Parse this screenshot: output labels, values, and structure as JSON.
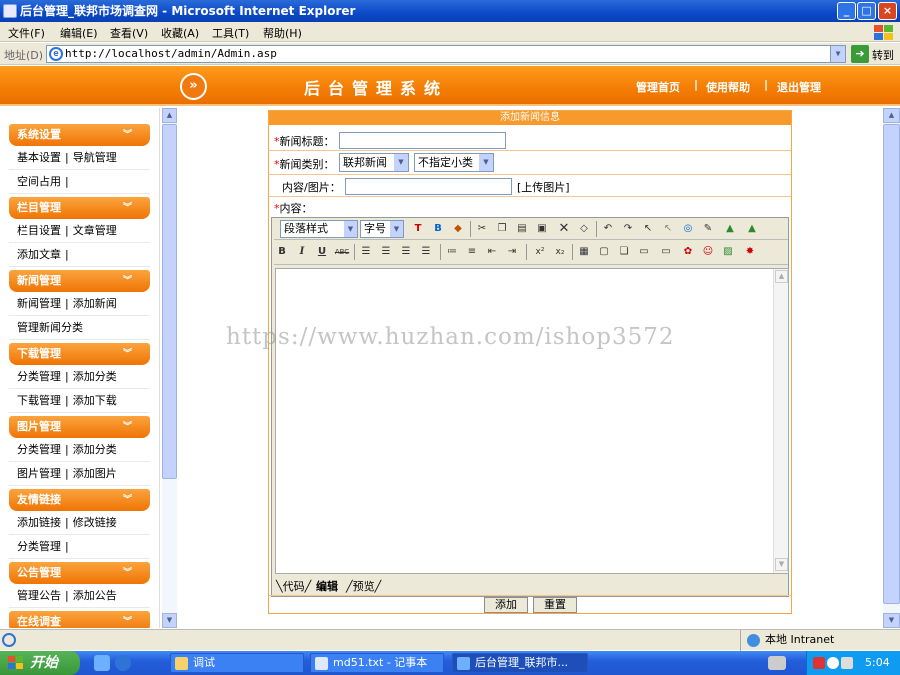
{
  "window": {
    "title": "后台管理_联邦市场调查网 - Microsoft Internet Explorer",
    "min": "_",
    "max": "□",
    "close": "×"
  },
  "menu": [
    "文件(F)",
    "编辑(E)",
    "查看(V)",
    "收藏(A)",
    "工具(T)",
    "帮助(H)"
  ],
  "address": {
    "label": "地址(D)",
    "url": "http://localhost/admin/Admin.asp",
    "go": "转到"
  },
  "header": {
    "logo_glyph": "»",
    "title": "后台管理系统",
    "nav": [
      "管理首页",
      "使用帮助",
      "退出管理"
    ],
    "sep": "|"
  },
  "sidebar": [
    {
      "title": "系统设置",
      "rows": [
        [
          "基本设置",
          "导航管理"
        ],
        [
          "空间占用",
          ""
        ]
      ]
    },
    {
      "title": "栏目管理",
      "rows": [
        [
          "栏目设置",
          "文章管理"
        ],
        [
          "添加文章",
          ""
        ]
      ]
    },
    {
      "title": "新闻管理",
      "rows": [
        [
          "新闻管理",
          "添加新闻"
        ],
        [
          "管理新闻分类"
        ]
      ]
    },
    {
      "title": "下载管理",
      "rows": [
        [
          "分类管理",
          "添加分类"
        ],
        [
          "下载管理",
          "添加下载"
        ]
      ]
    },
    {
      "title": "图片管理",
      "rows": [
        [
          "分类管理",
          "添加分类"
        ],
        [
          "图片管理",
          "添加图片"
        ]
      ]
    },
    {
      "title": "友情链接",
      "rows": [
        [
          "添加链接",
          "修改链接"
        ],
        [
          "分类管理",
          ""
        ]
      ]
    },
    {
      "title": "公告管理",
      "rows": [
        [
          "管理公告",
          "添加公告"
        ]
      ]
    },
    {
      "title": "在线调查",
      "rows": []
    }
  ],
  "form": {
    "header": "添加新闻信息",
    "title_label": "新闻标题：",
    "category_label": "新闻类别：",
    "category_value": "联邦新闻",
    "subcategory_value": "不指定小类",
    "image_label": "内容/图片：",
    "upload_link": "[上传图片]",
    "content_label": "内容：",
    "required_mark": "*",
    "add_button": "添加",
    "reset_button": "重置"
  },
  "editor": {
    "paragraph_style": "段落样式",
    "font_size": "字号",
    "tabs": [
      "代码",
      "编辑",
      "预览"
    ],
    "toolbar1_icons": [
      "fore-color-icon",
      "back-color-icon",
      "highlight-icon",
      "cut-icon",
      "copy-icon",
      "paste-icon",
      "paste-text-icon",
      "delete-icon",
      "eraser-icon",
      "undo-icon",
      "redo-icon",
      "select-all-icon",
      "unselect-icon",
      "find-icon",
      "spellcheck-icon",
      "link-icon",
      "unlink-icon"
    ],
    "toolbar2_icons": [
      "bold-icon",
      "italic-icon",
      "underline-icon",
      "strikethrough-icon",
      "align-left-icon",
      "align-center-icon",
      "align-right-icon",
      "justify-icon",
      "ordered-list-icon",
      "unordered-list-icon",
      "outdent-icon",
      "indent-icon",
      "superscript-icon",
      "subscript-icon",
      "table-icon",
      "frame-icon",
      "page-icon",
      "hr-icon",
      "marquee-icon",
      "special-char-icon",
      "emoticon-icon",
      "image-icon",
      "flash-icon"
    ]
  },
  "watermark": "https://www.huzhan.com/ishop3572",
  "status": {
    "zone": "本地 Intranet"
  },
  "taskbar": {
    "start": "开始",
    "tasks": [
      "调试",
      "md51.txt - 记事本",
      "后台管理_联邦市..."
    ],
    "clock": "5:04"
  }
}
